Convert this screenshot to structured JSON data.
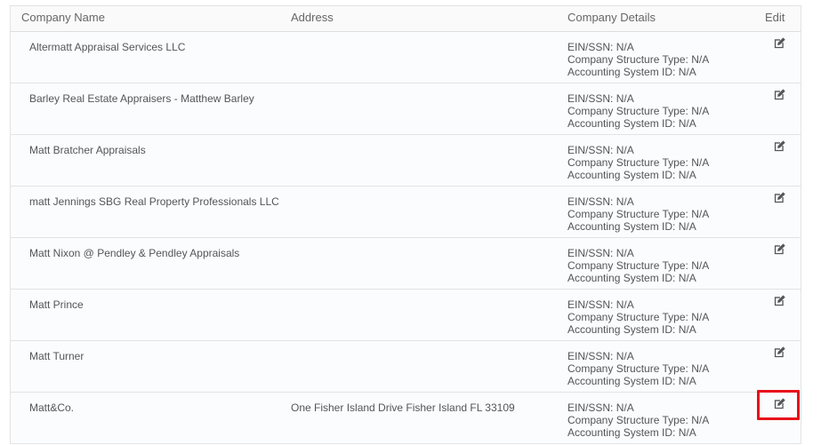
{
  "columns": {
    "name": "Company Name",
    "address": "Address",
    "details": "Company Details",
    "edit": "Edit"
  },
  "detail_labels": {
    "ein": "EIN/SSN:",
    "structure": "Company Structure Type:",
    "accounting": "Accounting System ID:"
  },
  "rows": [
    {
      "name": "Altermatt Appraisal Services LLC",
      "address": "",
      "ein": "N/A",
      "structure": "N/A",
      "accounting": "N/A"
    },
    {
      "name": "Barley Real Estate Appraisers - Matthew Barley",
      "address": "",
      "ein": "N/A",
      "structure": "N/A",
      "accounting": "N/A"
    },
    {
      "name": "Matt Bratcher Appraisals",
      "address": "",
      "ein": "N/A",
      "structure": "N/A",
      "accounting": "N/A"
    },
    {
      "name": "matt Jennings SBG Real Property Professionals LLC",
      "address": "",
      "ein": "N/A",
      "structure": "N/A",
      "accounting": "N/A"
    },
    {
      "name": "Matt Nixon @ Pendley & Pendley Appraisals",
      "address": "",
      "ein": "N/A",
      "structure": "N/A",
      "accounting": "N/A"
    },
    {
      "name": "Matt Prince",
      "address": "",
      "ein": "N/A",
      "structure": "N/A",
      "accounting": "N/A"
    },
    {
      "name": "Matt Turner",
      "address": "",
      "ein": "N/A",
      "structure": "N/A",
      "accounting": "N/A"
    },
    {
      "name": "Matt&Co.",
      "address": "One Fisher Island Drive Fisher Island FL 33109",
      "ein": "N/A",
      "structure": "N/A",
      "accounting": "N/A"
    }
  ],
  "icons": {
    "edit": "edit-icon"
  },
  "colors": {
    "highlight": "#e8111a",
    "border": "#e3e3e3",
    "text": "#555555"
  }
}
